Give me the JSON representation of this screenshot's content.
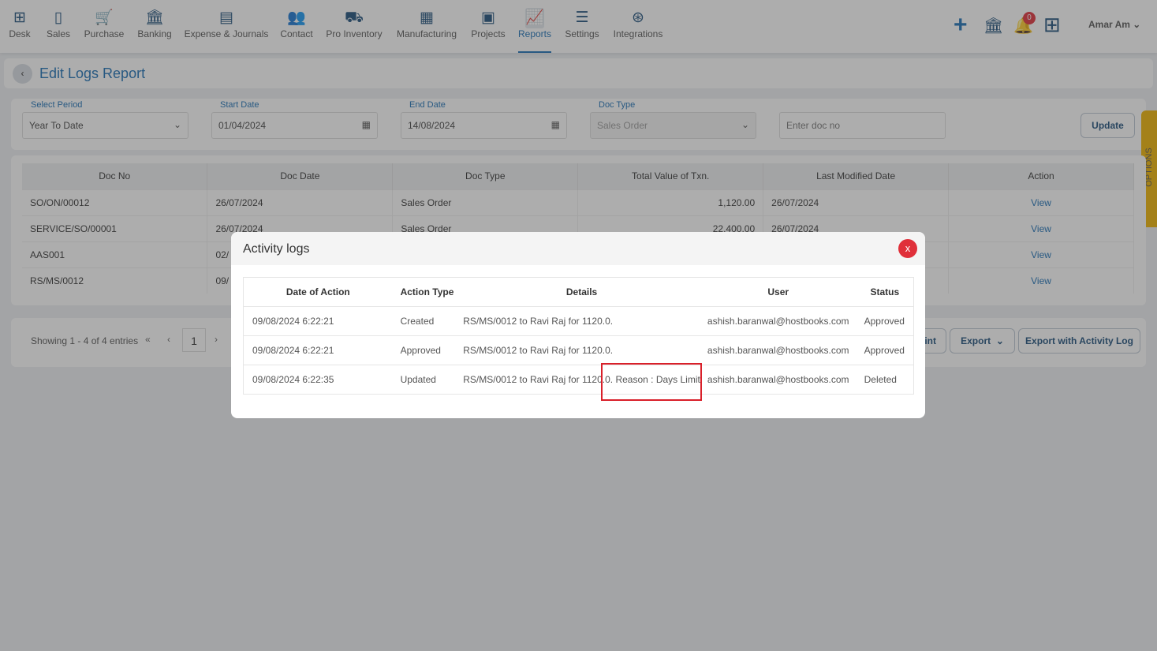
{
  "nav": {
    "items": [
      {
        "label": "Desk",
        "icon": "desk-grid-icon",
        "glyph": "⊞"
      },
      {
        "label": "Sales",
        "icon": "sales-receipt-icon",
        "glyph": "▯"
      },
      {
        "label": "Purchase",
        "icon": "cart-icon",
        "glyph": "🛒"
      },
      {
        "label": "Banking",
        "icon": "bank-icon",
        "glyph": "🏛"
      },
      {
        "label": "Expense & Journals",
        "icon": "journal-icon",
        "glyph": "▤"
      },
      {
        "label": "Contact",
        "icon": "contacts-icon",
        "glyph": "👥"
      },
      {
        "label": "Pro Inventory",
        "icon": "inventory-trolley-icon",
        "glyph": "⛟"
      },
      {
        "label": "Manufacturing",
        "icon": "factory-icon",
        "glyph": "▦"
      },
      {
        "label": "Projects",
        "icon": "projects-clipboard-icon",
        "glyph": "▣"
      },
      {
        "label": "Reports",
        "icon": "reports-chart-icon",
        "glyph": "📈"
      },
      {
        "label": "Settings",
        "icon": "sliders-icon",
        "glyph": "☰"
      },
      {
        "label": "Integrations",
        "icon": "plug-icon",
        "glyph": "⊛"
      }
    ],
    "active": "Reports",
    "notification_count": "0",
    "user": "Amar Am"
  },
  "page": {
    "title": "Edit Logs Report"
  },
  "filters": {
    "period": {
      "label": "Select Period",
      "value": "Year To Date"
    },
    "start": {
      "label": "Start Date",
      "value": "01/04/2024"
    },
    "end": {
      "label": "End Date",
      "value": "14/08/2024"
    },
    "doctype": {
      "label": "Doc Type",
      "value": "Sales Order"
    },
    "docno": {
      "placeholder": "Enter doc no"
    },
    "update": "Update"
  },
  "options_tab": "OPTIONS",
  "table": {
    "headers": [
      "Doc No",
      "Doc Date",
      "Doc Type",
      "Total Value of Txn.",
      "Last Modified Date",
      "Action"
    ],
    "rows": [
      [
        "SO/ON/00012",
        "26/07/2024",
        "Sales Order",
        "1,120.00",
        "26/07/2024",
        "View"
      ],
      [
        "SERVICE/SO/00001",
        "26/07/2024",
        "Sales Order",
        "22,400.00",
        "26/07/2024",
        "View"
      ],
      [
        "AAS001",
        "02/",
        "",
        "",
        "",
        "View"
      ],
      [
        "RS/MS/0012",
        "09/",
        "",
        "",
        "",
        "View"
      ]
    ]
  },
  "pagination": {
    "summary": "Showing 1 - 4 of 4 entries",
    "page": "1"
  },
  "actions": {
    "print": "Print",
    "export": "Export",
    "export_log": "Export with Activity Log"
  },
  "modal": {
    "title": "Activity logs",
    "close": "x",
    "headers": [
      "Date of Action",
      "Action Type",
      "Details",
      "User",
      "Status"
    ],
    "rows": [
      [
        "09/08/2024 6:22:21",
        "Created",
        "RS/MS/0012 to Ravi Raj for 1120.0.",
        "ashish.baranwal@hostbooks.com",
        "Approved"
      ],
      [
        "09/08/2024 6:22:21",
        "Approved",
        "RS/MS/0012 to Ravi Raj for 1120.0.",
        "ashish.baranwal@hostbooks.com",
        "Approved"
      ],
      [
        "09/08/2024 6:22:35",
        "Updated",
        "RS/MS/0012 to Ravi Raj for 1120.0. Reason : Days Limit",
        "ashish.baranwal@hostbooks.com",
        "Deleted"
      ]
    ]
  },
  "colors": {
    "accent": "#1b6fb5",
    "highlight": "#d9202a",
    "options": "#f0b400"
  }
}
